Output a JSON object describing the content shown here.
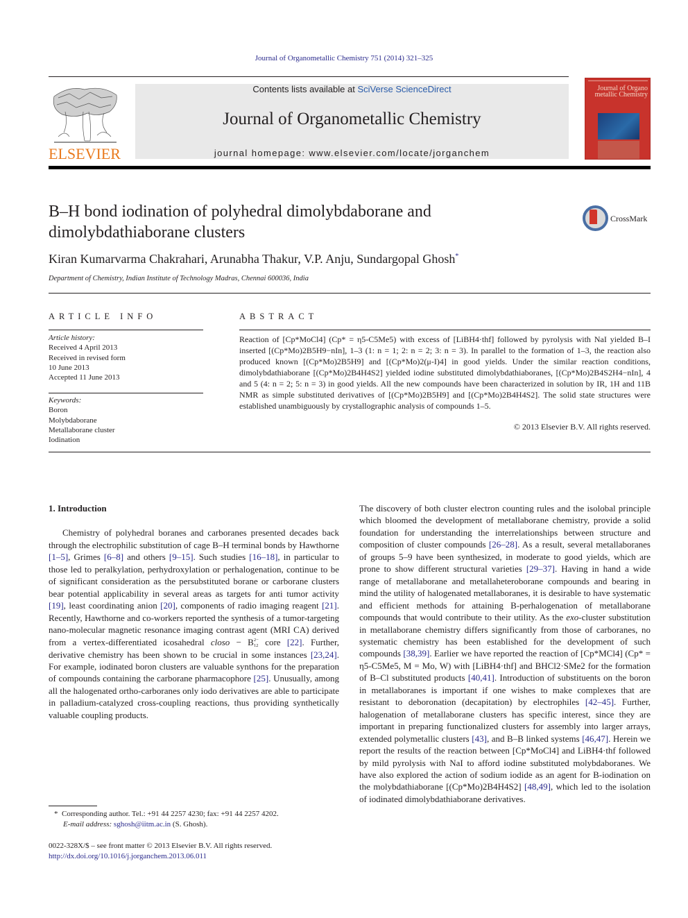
{
  "running_head": "Journal of Organometallic Chemistry 751 (2014) 321–325",
  "header": {
    "contents_prefix": "Contents lists available at ",
    "contents_link": "SciVerse ScienceDirect",
    "journal_title": "Journal of Organometallic Chemistry",
    "homepage_prefix": "journal homepage: ",
    "homepage_url": "www.elsevier.com/locate/jorganchem",
    "publisher_logo_text": "ELSEVIER",
    "cover_title": "Journal of Organo metallic Chemistry",
    "brand_color": "#e97a1e",
    "cover_color": "#c8332c"
  },
  "article": {
    "title": "B–H bond iodination of polyhedral dimolybdaborane and dimolybdathiaborane clusters",
    "crossmark_label": "CrossMark",
    "authors": "Kiran Kumarvarma Chakrahari, Arunabha Thakur, V.P. Anju, Sundargopal Ghosh",
    "corresponding_mark": "*",
    "affiliation": "Department of Chemistry, Indian Institute of Technology Madras, Chennai 600036, India"
  },
  "article_info": {
    "heading": "ARTICLE INFO",
    "history_label": "Article history:",
    "history": [
      "Received 4 April 2013",
      "Received in revised form",
      "10 June 2013",
      "Accepted 11 June 2013"
    ],
    "keywords_label": "Keywords:",
    "keywords": [
      "Boron",
      "Molybdaborane",
      "Metallaborane cluster",
      "Iodination"
    ]
  },
  "abstract": {
    "heading": "ABSTRACT",
    "text_segments": [
      "Reaction of [Cp*MoCl4] (Cp* = η5-C5Me5) with excess of [LiBH4·thf] followed by pyrolysis with NaI yielded B–I inserted [(Cp*Mo)2B5H9−nIn], 1–3 (1: n = 1; 2: n = 2; 3: n = 3). In parallel to the formation of 1–3, the reaction also produced known [(Cp*Mo)2B5H9] and [(Cp*Mo)2(μ-I)4] in good yields. Under the similar reaction conditions, dimolybdathiaborane [(Cp*Mo)2B4H4S2] yielded iodine substituted dimolybdathiaboranes, [(Cp*Mo)2B4S2H4−nIn], 4 and 5 (4: n = 2; 5: n = 3) in good yields. All the new compounds have been characterized in solution by IR, 1H and 11B NMR as simple substituted derivatives of [(Cp*Mo)2B5H9] and [(Cp*Mo)2B4H4S2]. The solid state structures were established unambiguously by crystallographic analysis of compounds 1–5."
    ],
    "copyright": "© 2013 Elsevier B.V. All rights reserved."
  },
  "introduction": {
    "heading": "1.  Introduction",
    "p1": {
      "t1": "Chemistry of polyhedral boranes and carboranes presented decades back through the electrophilic substitution of cage B–H terminal bonds by Hawthorne ",
      "c1": "[1–5]",
      "t2": ", Grimes ",
      "c2": "[6–8]",
      "t3": " and others ",
      "c3": "[9–15]",
      "t4": ". Such studies ",
      "c4": "[16–18]",
      "t5": ", in particular to those led to peralkylation, perhydroxylation or perhalogenation, continue to be of significant consideration as the persubstituted borane or carborane clusters bear potential applicability in several areas as targets for anti tumor activity ",
      "c5": "[19]",
      "t6": ", least coordinating anion ",
      "c6": "[20]",
      "t7": ", components of radio imaging reagent ",
      "c7": "[21]",
      "t8": ". Recently, Hawthorne and co-workers reported the synthesis of a tumor-targeting nano-molecular magnetic resonance imaging contrast agent (MRI CA) derived from a vertex-differentiated icosahedral ",
      "closo": "closo",
      "t9": " − B",
      "b12_sub": "12",
      "b12_sup": "2−",
      "t10": " core ",
      "c8": "[22]",
      "t11": ". Further, derivative chemistry has been shown to be crucial in some instances ",
      "c9": "[23,24]",
      "t12": ". For example, iodinated boron clusters are valuable synthons for the preparation of compounds containing the carborane pharmacophore ",
      "c10": "[25]",
      "t13": ". Unusually, among all the halogenated ortho-carboranes only iodo derivatives are able to participate in palladium-catalyzed cross-coupling reactions, thus providing synthetically valuable coupling products."
    },
    "p2": {
      "t1": "The discovery of both cluster electron counting rules and the isolobal principle which bloomed the development of metallaborane chemistry, provide a solid foundation for understanding the interrelationships between structure and composition of cluster compounds ",
      "c1": "[26–28]",
      "t2": ". As a result, several metallaboranes of groups 5–9 have been synthesized, in moderate to good yields, which are prone to show different structural varieties ",
      "c2": "[29–37]",
      "t3": ". Having in hand a wide range of metallaborane and metallaheteroborane compounds and bearing in mind the utility of halogenated metallaboranes, it is desirable to have systematic and efficient methods for attaining B-perhalogenation of metallaborane compounds that would contribute to their utility. As the ",
      "exo": "exo",
      "t4": "-cluster substitution in metallaborane chemistry differs significantly from those of carboranes, no systematic chemistry has been established for the development of such compounds ",
      "c3": "[38,39]",
      "t5": ". Earlier we have reported the reaction of [Cp*MCl4] (Cp* = η5-C5Me5, M = Mo, W) with [LiBH4·thf] and BHCl2·SMe2 for the formation of B–Cl substituted products ",
      "c4": "[40,41]",
      "t6": ". Introduction of substituents on the boron in metallaboranes is important if one wishes to make complexes that are resistant to deboronation (decapitation) by electrophiles ",
      "c5": "[42–45]",
      "t7": ". Further, halogenation of metallaborane clusters has specific interest, since they are important in preparing functionalized clusters for assembly into larger arrays, extended polymetallic clusters ",
      "c6": "[43]",
      "t8": ", and B–B linked systems ",
      "c7": "[46,47]",
      "t9": ". Herein we report the results of the reaction between [Cp*MoCl4] and LiBH4·thf followed by mild pyrolysis with NaI to afford iodine substituted molybdaboranes. We have also explored the action of sodium iodide as an agent for B-iodination on the molybdathiaborane [(Cp*Mo)2B4H4S2] ",
      "c8": "[48,49]",
      "t10": ", which led to the isolation of iodinated dimolybdathiaborane derivatives."
    }
  },
  "footnote": {
    "mark": "*",
    "text": "Corresponding author. Tel.: +91 44 2257 4230; fax: +91 44 2257 4202.",
    "email_label": "E-mail address:",
    "email": "sghosh@iitm.ac.in",
    "email_suffix": "(S. Ghosh)."
  },
  "front_matter": {
    "line": "0022-328X/$ – see front matter © 2013 Elsevier B.V. All rights reserved.",
    "doi": "http://dx.doi.org/10.1016/j.jorganchem.2013.06.011"
  }
}
